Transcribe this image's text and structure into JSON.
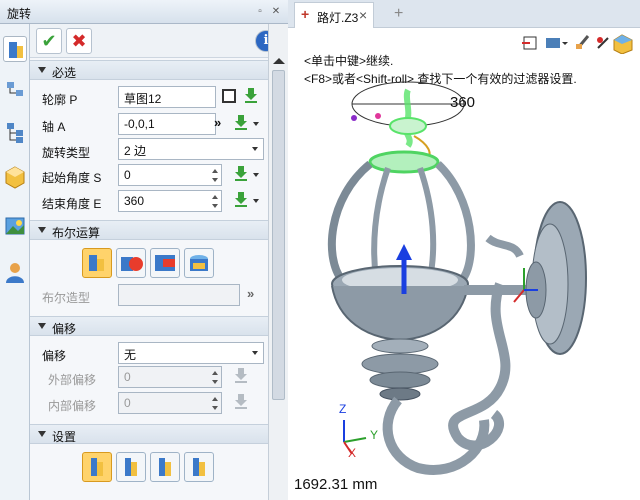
{
  "window": {
    "title": "旋转"
  },
  "tab": {
    "label": "路灯.Z3",
    "plus": "+",
    "close": "×"
  },
  "sections": {
    "required": "必选",
    "boolean": "布尔运算",
    "offset": "偏移",
    "settings": "设置"
  },
  "form": {
    "profile": {
      "label": "轮廓 P",
      "value": "草图12"
    },
    "axis": {
      "label": "轴 A",
      "value": "-0,0,1"
    },
    "rotate_type": {
      "label": "旋转类型",
      "value": "2 边"
    },
    "start_angle": {
      "label": "起始角度 S",
      "value": "0"
    },
    "end_angle": {
      "label": "结束角度 E",
      "value": "360"
    },
    "boolean_shape": {
      "label": "布尔造型",
      "value": ""
    },
    "offset": {
      "label": "偏移",
      "value": "无"
    },
    "outer_offset": {
      "label": "外部偏移",
      "value": "0"
    },
    "inner_offset": {
      "label": "内部偏移",
      "value": "0"
    }
  },
  "viewport": {
    "hint1": "<单击中键>继续.",
    "hint2": "<F8>或者<Shift-roll> 查找下一个有效的过滤器设置.",
    "angle_label": "360",
    "distance": "1692.31 mm",
    "axes": {
      "x": "X",
      "y": "Y",
      "z": "Z"
    }
  },
  "colors": {
    "accent_green": "#3aa23a",
    "cancel_red": "#d42a2a",
    "model_gray": "#8d9aa6",
    "highlight_green": "#59e36a",
    "axis_blue": "#1a3fe0"
  }
}
